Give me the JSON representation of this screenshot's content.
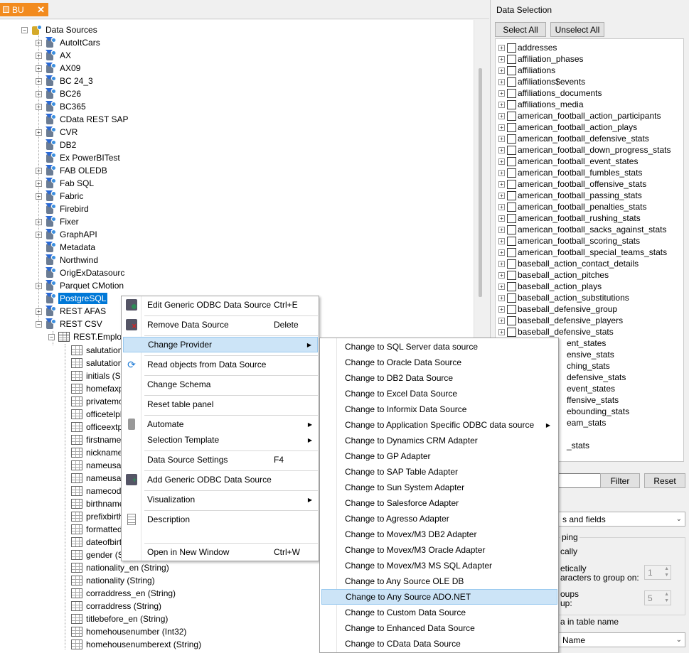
{
  "tab": {
    "label": "BU",
    "close": "✕"
  },
  "tree": {
    "root": "Data Sources",
    "sources": [
      "AutoItCars",
      "AX",
      "AX09",
      "BC 24_3",
      "BC26",
      "BC365",
      "CData REST SAP",
      "CVR",
      "DB2",
      "Ex PowerBITest",
      "FAB OLEDB",
      "Fab SQL",
      "Fabric",
      "Firebird",
      "Fixer",
      "GraphAPI",
      "Metadata",
      "Northwind",
      "OrigExDatasourc",
      "Parquet CMotion",
      "PostgreSQL",
      "REST AFAS",
      "REST CSV"
    ],
    "table": "REST.Employ",
    "fields": [
      "salutationi",
      "salutation",
      "initials (Str",
      "homefaxpl",
      "privatemol",
      "officetelph",
      "officeextpl",
      "firstname (",
      "nickname",
      "nameusag",
      "nameusag",
      "namecode",
      "birthname",
      "prefixbirthn",
      "formattedr",
      "dateofbirth",
      "gender (St",
      "nationality_en (String)",
      "nationality (String)",
      "corraddress_en (String)",
      "corraddress (String)",
      "titlebefore_en (String)",
      "homehousenumber (Int32)",
      "homehousenumberext (String)"
    ],
    "selected": "PostgreSQL"
  },
  "data_selection": {
    "title": "Data Selection",
    "select_all": "Select All",
    "unselect_all": "Unselect All",
    "items": [
      "addresses",
      "affiliation_phases",
      "affiliations",
      "affiliations$events",
      "affiliations_documents",
      "affiliations_media",
      "american_football_action_participants",
      "american_football_action_plays",
      "american_football_defensive_stats",
      "american_football_down_progress_stats",
      "american_football_event_states",
      "american_football_fumbles_stats",
      "american_football_offensive_stats",
      "american_football_passing_stats",
      "american_football_penalties_stats",
      "american_football_rushing_stats",
      "american_football_sacks_against_stats",
      "american_football_scoring_stats",
      "american_football_special_teams_stats",
      "baseball_action_contact_details",
      "baseball_action_pitches",
      "baseball_action_plays",
      "baseball_action_substitutions",
      "baseball_defensive_group",
      "baseball_defensive_players",
      "baseball_defensive_stats"
    ],
    "partial_items": [
      "ent_states",
      "ensive_stats",
      "ching_stats",
      "defensive_stats",
      "event_states",
      "ffensive_stats",
      "ebounding_stats",
      "eam_stats",
      "_stats"
    ],
    "filter_label": "Filter",
    "reset_label": "Reset",
    "dropdown_value": "s and fields",
    "group_title": "ping",
    "opt_cally": "cally",
    "opt_etically": "etically",
    "chars_label": "aracters to group on:",
    "chars_value": "1",
    "oups_label": "oups",
    "up_label": "up:",
    "groups_value": "5",
    "table_name_label": "a in table name",
    "name_dropdown": "Name"
  },
  "context_menu": {
    "items": [
      {
        "label": "Edit Generic ODBC Data Source",
        "shortcut": "Ctrl+E"
      },
      {
        "label": "Remove Data Source",
        "shortcut": "Delete"
      },
      {
        "label": "Change Provider",
        "shortcut": ""
      },
      {
        "label": "Read objects from Data Source",
        "shortcut": ""
      },
      {
        "label": "Change Schema",
        "shortcut": ""
      },
      {
        "label": "Reset table panel",
        "shortcut": ""
      },
      {
        "label": "Automate",
        "shortcut": ""
      },
      {
        "label": "Selection Template",
        "shortcut": ""
      },
      {
        "label": "Data Source Settings",
        "shortcut": "F4"
      },
      {
        "label": "Add Generic ODBC Data Source",
        "shortcut": ""
      },
      {
        "label": "Visualization",
        "shortcut": ""
      },
      {
        "label": "Description",
        "shortcut": ""
      },
      {
        "label": "Open in New Window",
        "shortcut": "Ctrl+W"
      }
    ]
  },
  "submenu": {
    "items": [
      "Change to SQL Server data source",
      "Change to Oracle Data Source",
      "Change to DB2 Data Source",
      "Change to Excel Data Source",
      "Change to Informix Data Source",
      "Change to Application Specific ODBC data source",
      "Change to Dynamics CRM Adapter",
      "Change to GP Adapter",
      "Change to SAP Table Adapter",
      "Change to Sun System Adapter",
      "Change to Salesforce Adapter",
      "Change to Agresso Adapter",
      "Change to Movex/M3 DB2 Adapter",
      "Change to Movex/M3 Oracle Adapter",
      "Change to Movex/M3 MS SQL Adapter",
      "Change to Any Source OLE DB",
      "Change to Any Source ADO.NET",
      "Change to Custom Data Source",
      "Change to Enhanced Data Source",
      "Change to CData Data Source"
    ],
    "highlighted": "Change to Any Source ADO.NET"
  }
}
